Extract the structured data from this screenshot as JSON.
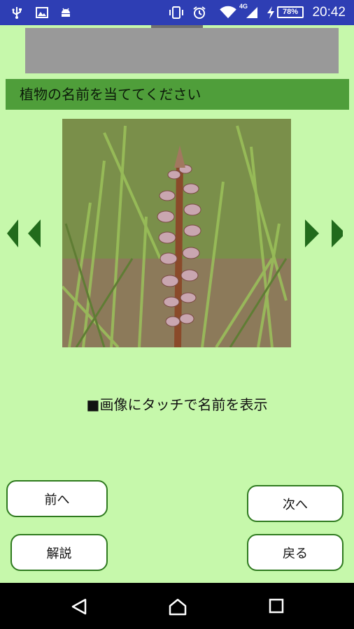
{
  "status_bar": {
    "time": "20:42",
    "battery_percent": "78%",
    "network_label": "4G",
    "icons": [
      "usb-icon",
      "image-notification-icon",
      "android-debug-icon",
      "vibrate-icon",
      "alarm-icon",
      "wifi-icon",
      "signal-icon",
      "charging-icon",
      "battery-icon"
    ],
    "background_color": "#2e3eb4"
  },
  "header": {
    "title": "植物の名前を当ててください"
  },
  "quiz": {
    "hint": "■画像にタッチで名前を表示",
    "prev_arrow_icon": "double-left-arrow-icon",
    "next_arrow_icon": "double-right-arrow-icon"
  },
  "buttons": {
    "prev": "前へ",
    "next": "次へ",
    "explain": "解説",
    "back": "戻る"
  },
  "navigation_bar": {
    "icons": [
      "back-triangle-icon",
      "home-icon",
      "recents-icon"
    ]
  },
  "colors": {
    "background": "#c6f8ab",
    "title_bar": "#4f9e3a",
    "arrow": "#226b1c",
    "button_border": "#2f7a1f",
    "ad_placeholder": "#999999"
  }
}
